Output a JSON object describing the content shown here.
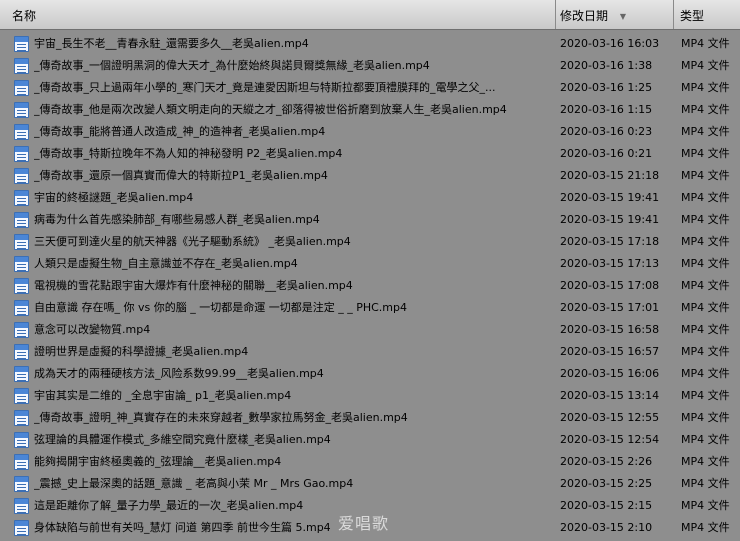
{
  "header": {
    "name_label": "名称",
    "date_label": "修改日期",
    "type_label": "类型",
    "sort_arrow": "▼"
  },
  "files": [
    {
      "name": "宇宙_長生不老__青春永駐_還需要多久__老吳alien.mp4",
      "date": "2020-03-16 16:03",
      "type": "MP4 文件"
    },
    {
      "name": "_傳奇故事_一個證明黑洞的偉大天才_為什麼始終與諾貝爾獎無緣_老吳alien.mp4",
      "date": "2020-03-16 1:38",
      "type": "MP4 文件"
    },
    {
      "name": "_傳奇故事_只上過兩年小學的_寒门天才_竟是連愛因斯坦与特斯拉都要頂禮膜拜的_電學之父_...",
      "date": "2020-03-16 1:25",
      "type": "MP4 文件"
    },
    {
      "name": "_傳奇故事_他是兩次改變人類文明走向的天縱之才_卻落得被世俗折磨到放棄人生_老吳alien.mp4",
      "date": "2020-03-16 1:15",
      "type": "MP4 文件"
    },
    {
      "name": "_傳奇故事_能將普通人改造成_神_的造神者_老吳alien.mp4",
      "date": "2020-03-16 0:23",
      "type": "MP4 文件"
    },
    {
      "name": "_傳奇故事_特斯拉晚年不為人知的神秘發明 P2_老吳alien.mp4",
      "date": "2020-03-16 0:21",
      "type": "MP4 文件"
    },
    {
      "name": "_傳奇故事_還原一個真實而偉大的特斯拉P1_老吳alien.mp4",
      "date": "2020-03-15 21:18",
      "type": "MP4 文件"
    },
    {
      "name": "宇宙的終極謎題_老吳alien.mp4",
      "date": "2020-03-15 19:41",
      "type": "MP4 文件"
    },
    {
      "name": "病毒为什么首先感染肺部_有哪些易感人群_老吳alien.mp4",
      "date": "2020-03-15 19:41",
      "type": "MP4 文件"
    },
    {
      "name": "三天便可到達火星的航天神器《光子驅動系統》 _老吳alien.mp4",
      "date": "2020-03-15 17:18",
      "type": "MP4 文件"
    },
    {
      "name": "人類只是虛擬生物_自主意識並不存在_老吳alien.mp4",
      "date": "2020-03-15 17:13",
      "type": "MP4 文件"
    },
    {
      "name": "電視機的雪花點跟宇宙大爆炸有什麼神秘的關聯__老吳alien.mp4",
      "date": "2020-03-15 17:08",
      "type": "MP4 文件"
    },
    {
      "name": "自由意識 存在嗎_ 你 vs 你的腦 _ 一切都是命運 一切都是注定 _ _ PHC.mp4",
      "date": "2020-03-15 17:01",
      "type": "MP4 文件"
    },
    {
      "name": "意念可以改變物質.mp4",
      "date": "2020-03-15 16:58",
      "type": "MP4 文件"
    },
    {
      "name": "證明世界是虛擬的科學證據_老吳alien.mp4",
      "date": "2020-03-15 16:57",
      "type": "MP4 文件"
    },
    {
      "name": "成為天才的兩種硬核方法_风险系数99.99__老吳alien.mp4",
      "date": "2020-03-15 16:06",
      "type": "MP4 文件"
    },
    {
      "name": "宇宙其实是二维的 _全息宇宙論_ p1_老吳alien.mp4",
      "date": "2020-03-15 13:14",
      "type": "MP4 文件"
    },
    {
      "name": "_傳奇故事_證明_神_真實存在的未來穿越者_數學家拉馬努金_老吳alien.mp4",
      "date": "2020-03-15 12:55",
      "type": "MP4 文件"
    },
    {
      "name": "弦理論的具體運作模式_多維空間究竟什麼樣_老吳alien.mp4",
      "date": "2020-03-15 12:54",
      "type": "MP4 文件"
    },
    {
      "name": "能夠揭開宇宙終極奧義的_弦理論__老吳alien.mp4",
      "date": "2020-03-15 2:26",
      "type": "MP4 文件"
    },
    {
      "name": "_震撼_史上最深奧的話題_意識 _ 老高與小茉 Mr _ Mrs Gao.mp4",
      "date": "2020-03-15 2:25",
      "type": "MP4 文件"
    },
    {
      "name": "這是距離你了解_量子力學_最近的一次_老吳alien.mp4",
      "date": "2020-03-15 2:15",
      "type": "MP4 文件"
    },
    {
      "name": "身体缺陷与前世有关吗_慧灯 问道 第四季 前世今生篇 5.mp4",
      "date": "2020-03-15 2:10",
      "type": "MP4 文件"
    }
  ],
  "watermark": "爱唱歌",
  "icon_name": "mp4-file-icon"
}
